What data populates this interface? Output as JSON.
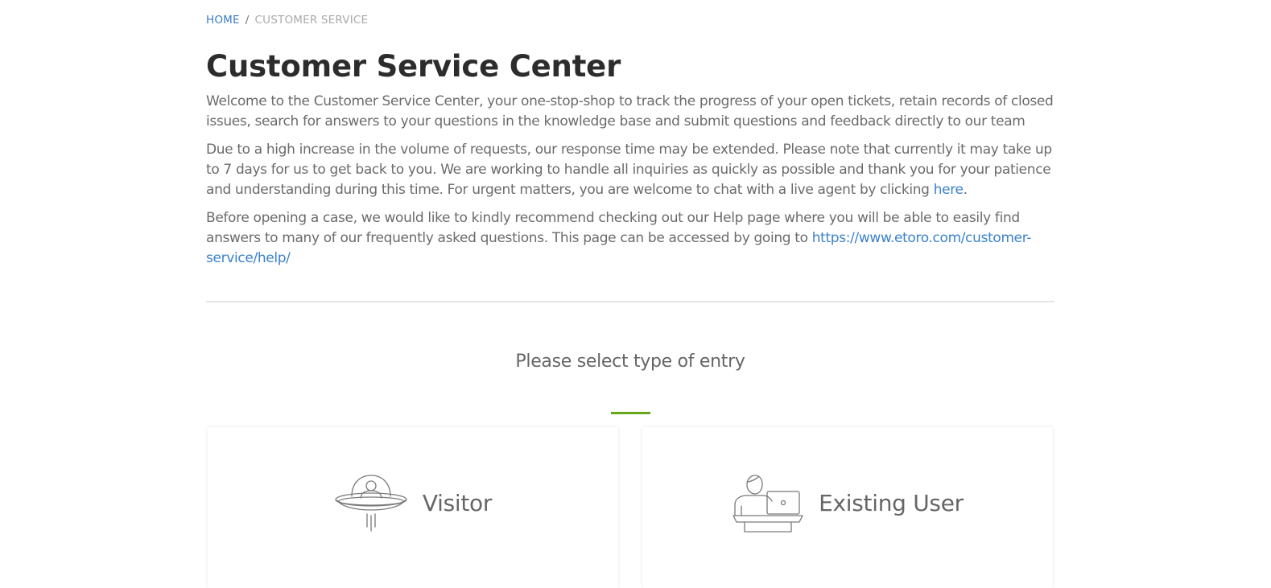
{
  "breadcrumb": {
    "home": "HOME",
    "separator": "/",
    "current": "CUSTOMER SERVICE"
  },
  "page": {
    "title": "Customer Service Center",
    "intro": "Welcome to the Customer Service Center, your one-stop-shop to track the progress of your open tickets, retain records of closed issues, search for answers to your questions in the knowledge base and submit questions and feedback directly to our team",
    "notice_text": "Due to a high increase in the volume of requests, our response time may be extended. Please note that currently it may take up to 7 days for us to get back to you. We are working to handle all inquiries as quickly as possible and thank you for your patience and understanding during this time. For urgent matters, you are welcome to chat with a live agent by clicking ",
    "notice_link": "here",
    "notice_end": ".",
    "help_text": "Before opening a case, we would like to kindly recommend checking out our Help page where you will be able to easily find answers to many of our frequently asked questions. This page can be accessed by going to ",
    "help_link": "https://www.etoro.com/customer-service/help/"
  },
  "entry": {
    "heading": "Please select type of entry",
    "options": [
      {
        "label": "Visitor",
        "icon": "ufo-astronaut-icon"
      },
      {
        "label": "Existing User",
        "icon": "user-at-laptop-icon"
      }
    ]
  },
  "colors": {
    "link": "#3b82cc",
    "title": "#2c2c2c",
    "accent_green": "#67a51a"
  }
}
